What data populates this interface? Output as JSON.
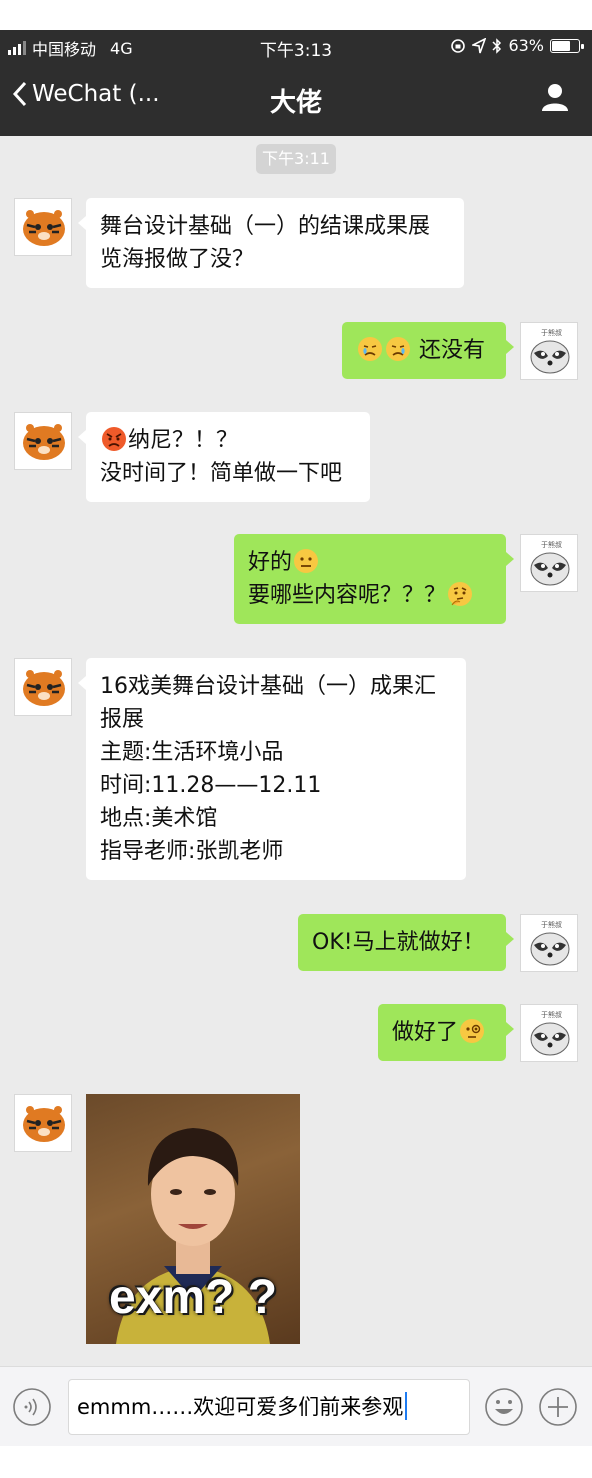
{
  "status_bar": {
    "carrier": "中国移动",
    "network": "4G",
    "time": "下午3:13",
    "battery": "63%",
    "battery_level": 0.63
  },
  "nav": {
    "back_label": "WeChat (...",
    "title": "大佬"
  },
  "chat": {
    "timestamp": "下午3:11",
    "messages": [
      {
        "side": "in",
        "lines": [
          "舞台设计基础（一）的结课成果展",
          "览海报做了没？"
        ]
      },
      {
        "side": "out",
        "lines": [
          "还没有"
        ]
      },
      {
        "side": "in",
        "lines": [
          "纳尼？！？",
          "没时间了！简单做一下吧"
        ]
      },
      {
        "side": "out",
        "lines": [
          "好的",
          "要哪些内容呢？？？"
        ]
      },
      {
        "side": "in",
        "lines": [
          "16戏美舞台设计基础（一）成果汇",
          "报展",
          "主题:生活环境小品",
          "时间:11.28——12.11",
          "地点:美术馆",
          "指导老师:张凯老师"
        ]
      },
      {
        "side": "out",
        "lines": [
          "OK!马上就做好！"
        ]
      },
      {
        "side": "out",
        "lines": [
          "做好了"
        ]
      }
    ],
    "sticker_caption": "exm? ?"
  },
  "input": {
    "value": "emmm……欢迎可爱多们前来参观"
  },
  "colors": {
    "bar": "#2e2e2e",
    "chat_bg": "#ebebeb",
    "incoming": "#ffffff",
    "outgoing": "#9fe65a"
  }
}
